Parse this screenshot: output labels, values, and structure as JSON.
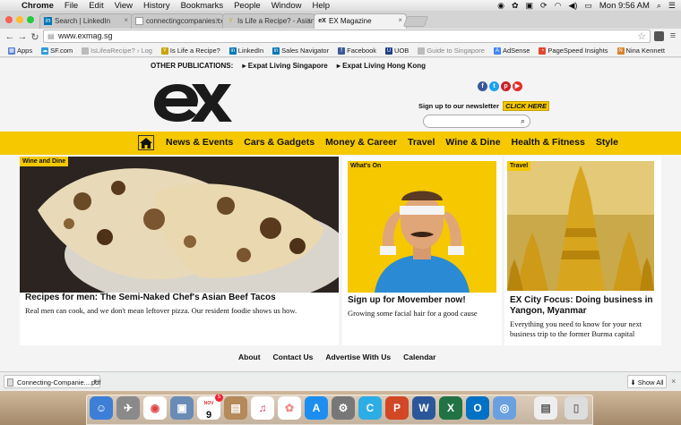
{
  "menubar": {
    "app": "Chrome",
    "items": [
      "File",
      "Edit",
      "View",
      "History",
      "Bookmarks",
      "People",
      "Window",
      "Help"
    ],
    "clock": "Mon 9:56 AM"
  },
  "tabs": [
    {
      "label": "Search | LinkedIn",
      "favicon": "in"
    },
    {
      "label": "connectingcompanies.co",
      "favicon": "doc"
    },
    {
      "label": "Is Life a Recipe? - Asian Re",
      "favicon": "Y"
    },
    {
      "label": "EX Magazine",
      "favicon": "ex"
    }
  ],
  "address": {
    "url": "www.exmag.sg"
  },
  "bookmarks": [
    {
      "label": "Apps",
      "icon": "apps-icon",
      "color": "#5b7fd6"
    },
    {
      "label": "SF.com",
      "icon": "cloud-icon",
      "color": "#2e9be0"
    },
    {
      "label": "IsLifeaRecipe? › Log",
      "icon": "doc-icon",
      "color": "#999999"
    },
    {
      "label": "Is Life a Recipe?",
      "icon": "y-icon",
      "color": "#c9a400"
    },
    {
      "label": "LinkedIn",
      "icon": "linkedin-icon",
      "color": "#0077b5"
    },
    {
      "label": "Sales Navigator",
      "icon": "linkedin-icon",
      "color": "#0077b5"
    },
    {
      "label": "Facebook",
      "icon": "facebook-icon",
      "color": "#3b5998"
    },
    {
      "label": "UOB",
      "icon": "uob-icon",
      "color": "#1f3c88"
    },
    {
      "label": "Guide to Singapore",
      "icon": "doc-icon",
      "color": "#999999"
    },
    {
      "label": "AdSense",
      "icon": "adsense-icon",
      "color": "#4285f4"
    },
    {
      "label": "PageSpeed Insights",
      "icon": "pagespeed-icon",
      "color": "#e0472f"
    },
    {
      "label": "Nina Kennett",
      "icon": "nk-icon",
      "color": "#d9822b"
    }
  ],
  "header": {
    "other_publications_label": "OTHER PUBLICATIONS:",
    "publications": [
      "Expat Living Singapore",
      "Expat Living Hong Kong"
    ],
    "logo_text": "eX",
    "newsletter_text": "Sign up to our newsletter",
    "newsletter_button": "CLICK HERE",
    "search_placeholder": ""
  },
  "nav": {
    "items": [
      "News & Events",
      "Cars & Gadgets",
      "Money & Career",
      "Travel",
      "Wine & Dine",
      "Health & Fitness",
      "Style"
    ]
  },
  "cards": [
    {
      "tag": "Wine and Dine",
      "title": "Recipes for men: The Semi-Naked Chef's Asian Beef Tacos",
      "desc": "Real men can cook, and we don't mean leftover pizza. Our resident foodie shows us how."
    },
    {
      "tag": "What's On",
      "title": "Sign up for Movember now!",
      "desc": "Growing some facial hair for a good cause"
    },
    {
      "tag": "Travel",
      "title": "EX City Focus: Doing business in Yangon, Myanmar",
      "desc": "Everything you need to know for your next business trip to the former Burma capital"
    }
  ],
  "footer": {
    "links": [
      "About",
      "Contact Us",
      "Advertise With Us",
      "Calendar"
    ]
  },
  "download_bar": {
    "file": "Connecting-Companie....pdf",
    "show_all": "Show All"
  },
  "dock_calendar": {
    "month": "NOV",
    "day": "9",
    "badge": "5"
  },
  "colors": {
    "brand_yellow": "#f5c800"
  }
}
